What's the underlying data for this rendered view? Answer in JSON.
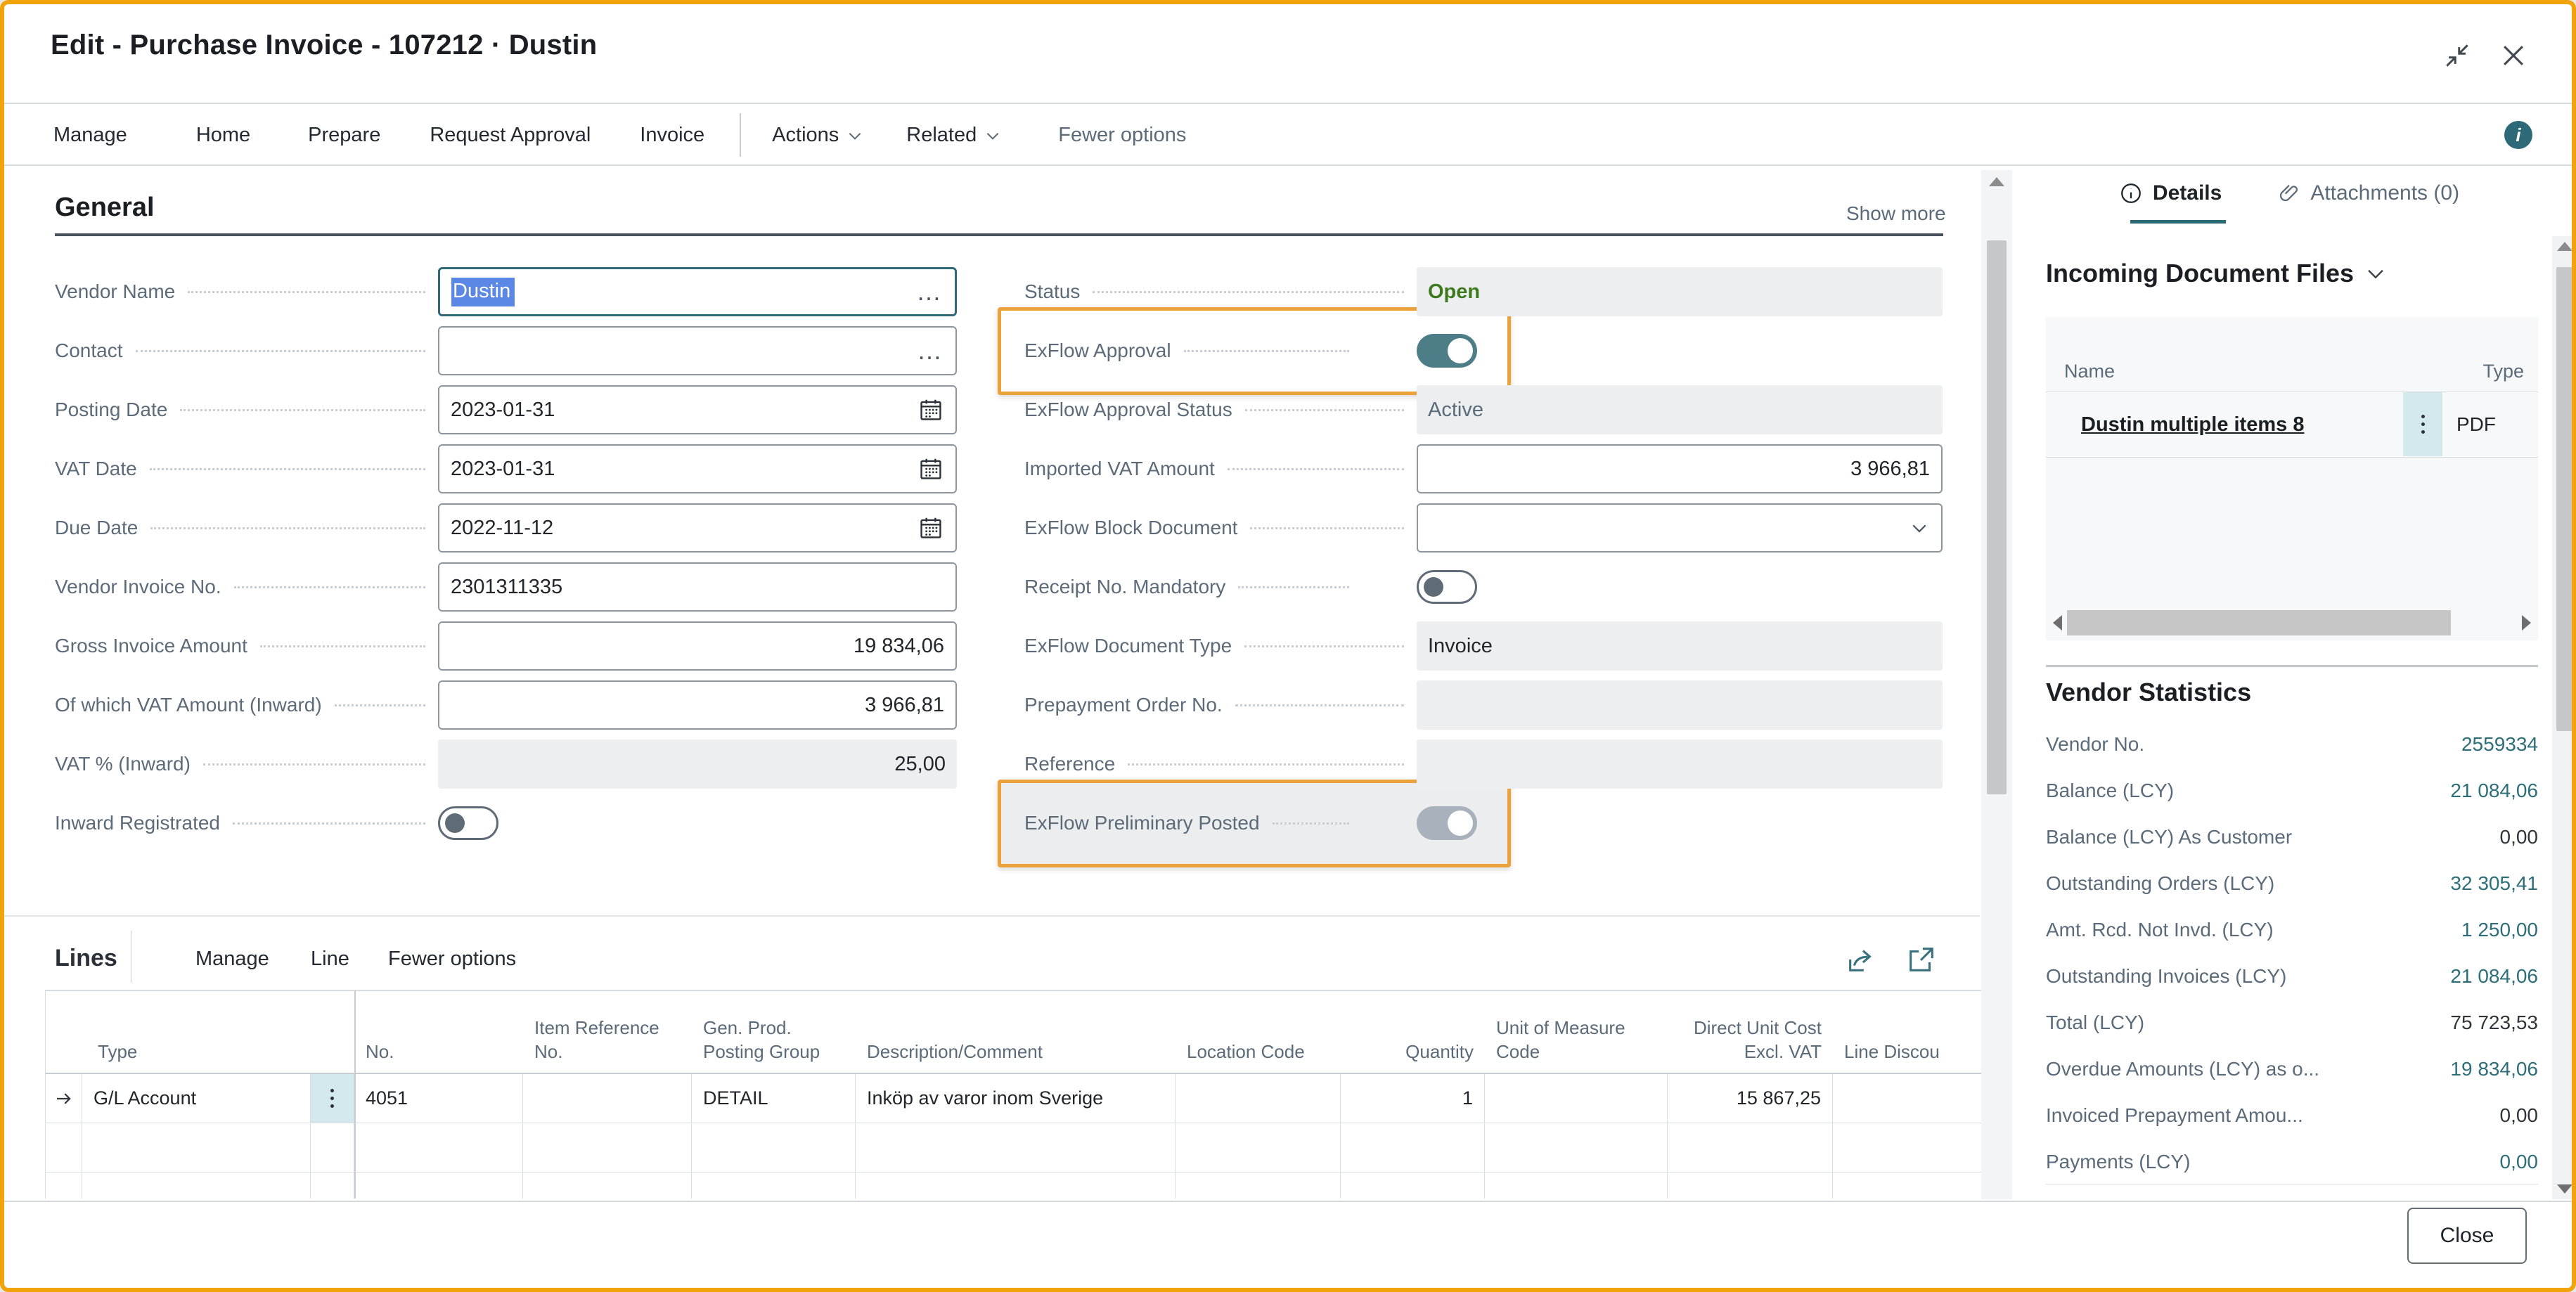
{
  "window": {
    "title": "Edit - Purchase Invoice - 107212 · Dustin"
  },
  "menubar": {
    "items": [
      "Manage",
      "Home",
      "Prepare",
      "Request Approval",
      "Invoice"
    ],
    "dropdowns": [
      "Actions",
      "Related"
    ],
    "fewer_options": "Fewer options"
  },
  "general": {
    "heading": "General",
    "show_more": "Show more",
    "left": [
      {
        "label": "Vendor Name",
        "value": "Dustin",
        "state": "focused-selected"
      },
      {
        "label": "Contact",
        "value": ""
      },
      {
        "label": "Posting Date",
        "value": "2023-01-31"
      },
      {
        "label": "VAT Date",
        "value": "2023-01-31"
      },
      {
        "label": "Due Date",
        "value": "2022-11-12"
      },
      {
        "label": "Vendor Invoice No.",
        "value": "2301311335"
      },
      {
        "label": "Gross Invoice Amount",
        "value": "19 834,06"
      },
      {
        "label": "Of which VAT Amount (Inward)",
        "value": "3 966,81"
      },
      {
        "label": "VAT % (Inward)",
        "value": "25,00"
      },
      {
        "label": "Inward Registrated",
        "value": "off"
      }
    ],
    "right": [
      {
        "label": "Status",
        "value": "Open"
      },
      {
        "label": "ExFlow Approval",
        "value": "on",
        "highlighted": true
      },
      {
        "label": "ExFlow Approval Status",
        "value": "Active"
      },
      {
        "label": "Imported VAT Amount",
        "value": "3 966,81"
      },
      {
        "label": "ExFlow Block Document",
        "value": ""
      },
      {
        "label": "Receipt No. Mandatory",
        "value": "off"
      },
      {
        "label": "ExFlow Document Type",
        "value": "Invoice"
      },
      {
        "label": "Prepayment Order No.",
        "value": ""
      },
      {
        "label": "Reference",
        "value": ""
      },
      {
        "label": "ExFlow Preliminary Posted",
        "value": "on-disabled",
        "highlighted": true
      }
    ]
  },
  "lines": {
    "heading": "Lines",
    "menu": [
      "Manage",
      "Line",
      "Fewer options"
    ],
    "columns": [
      "Type",
      "No.",
      "Item Reference No.",
      "Gen. Prod. Posting Group",
      "Description/Comment",
      "Location Code",
      "Quantity",
      "Unit of Measure Code",
      "Direct Unit Cost Excl. VAT",
      "Line Discou"
    ],
    "rows": [
      {
        "type": "G/L Account",
        "no": "4051",
        "item_ref": "",
        "gen_prod": "DETAIL",
        "description": "Inköp av varor inom Sverige",
        "location": "",
        "quantity": "1",
        "uom": "",
        "unit_cost": "15 867,25",
        "line_disc": ""
      }
    ]
  },
  "panel": {
    "tabs": [
      {
        "label": "Details",
        "active": true
      },
      {
        "label": "Attachments (0)",
        "active": false
      }
    ],
    "incoming_heading": "Incoming Document Files",
    "files": {
      "name_header": "Name",
      "type_header": "Type",
      "rows": [
        {
          "name": "Dustin multiple items 8",
          "type": "PDF"
        }
      ]
    },
    "stats_heading": "Vendor Statistics",
    "stats": [
      {
        "label": "Vendor No.",
        "value": "2559334",
        "link": true
      },
      {
        "label": "Balance (LCY)",
        "value": "21 084,06",
        "link": true
      },
      {
        "label": "Balance (LCY) As Customer",
        "value": "0,00",
        "link": false
      },
      {
        "label": "Outstanding Orders (LCY)",
        "value": "32 305,41",
        "link": true
      },
      {
        "label": "Amt. Rcd. Not Invd. (LCY)",
        "value": "1 250,00",
        "link": true
      },
      {
        "label": "Outstanding Invoices (LCY)",
        "value": "21 084,06",
        "link": true
      },
      {
        "label": "Total (LCY)",
        "value": "75 723,53",
        "link": false
      },
      {
        "label": "Overdue Amounts (LCY) as o...",
        "value": "19 834,06",
        "link": true
      },
      {
        "label": "Invoiced Prepayment Amou...",
        "value": "0,00",
        "link": false
      },
      {
        "label": "Payments (LCY)",
        "value": "0,00",
        "link": true
      }
    ]
  },
  "footer": {
    "close_label": "Close"
  },
  "icons": [
    "collapse-icon",
    "close-icon",
    "chevron-down-icon",
    "info-icon",
    "calendar-icon",
    "ellipsis-icon",
    "share-icon",
    "open-in-window-icon",
    "paperclip-icon",
    "details-info-icon",
    "row-marker-arrow-icon",
    "more-options-icon"
  ],
  "colors": {
    "window_border": "#F0A30A",
    "highlight_orange": "#EBA23B",
    "toggle_on_teal": "#4D7E88",
    "accent_teal": "#2C6A75",
    "status_green": "#3D7A1E",
    "link_teal": "#2D6E79",
    "selection_blue": "#5B87E5",
    "readonly_grey": "#EDEEF0"
  }
}
